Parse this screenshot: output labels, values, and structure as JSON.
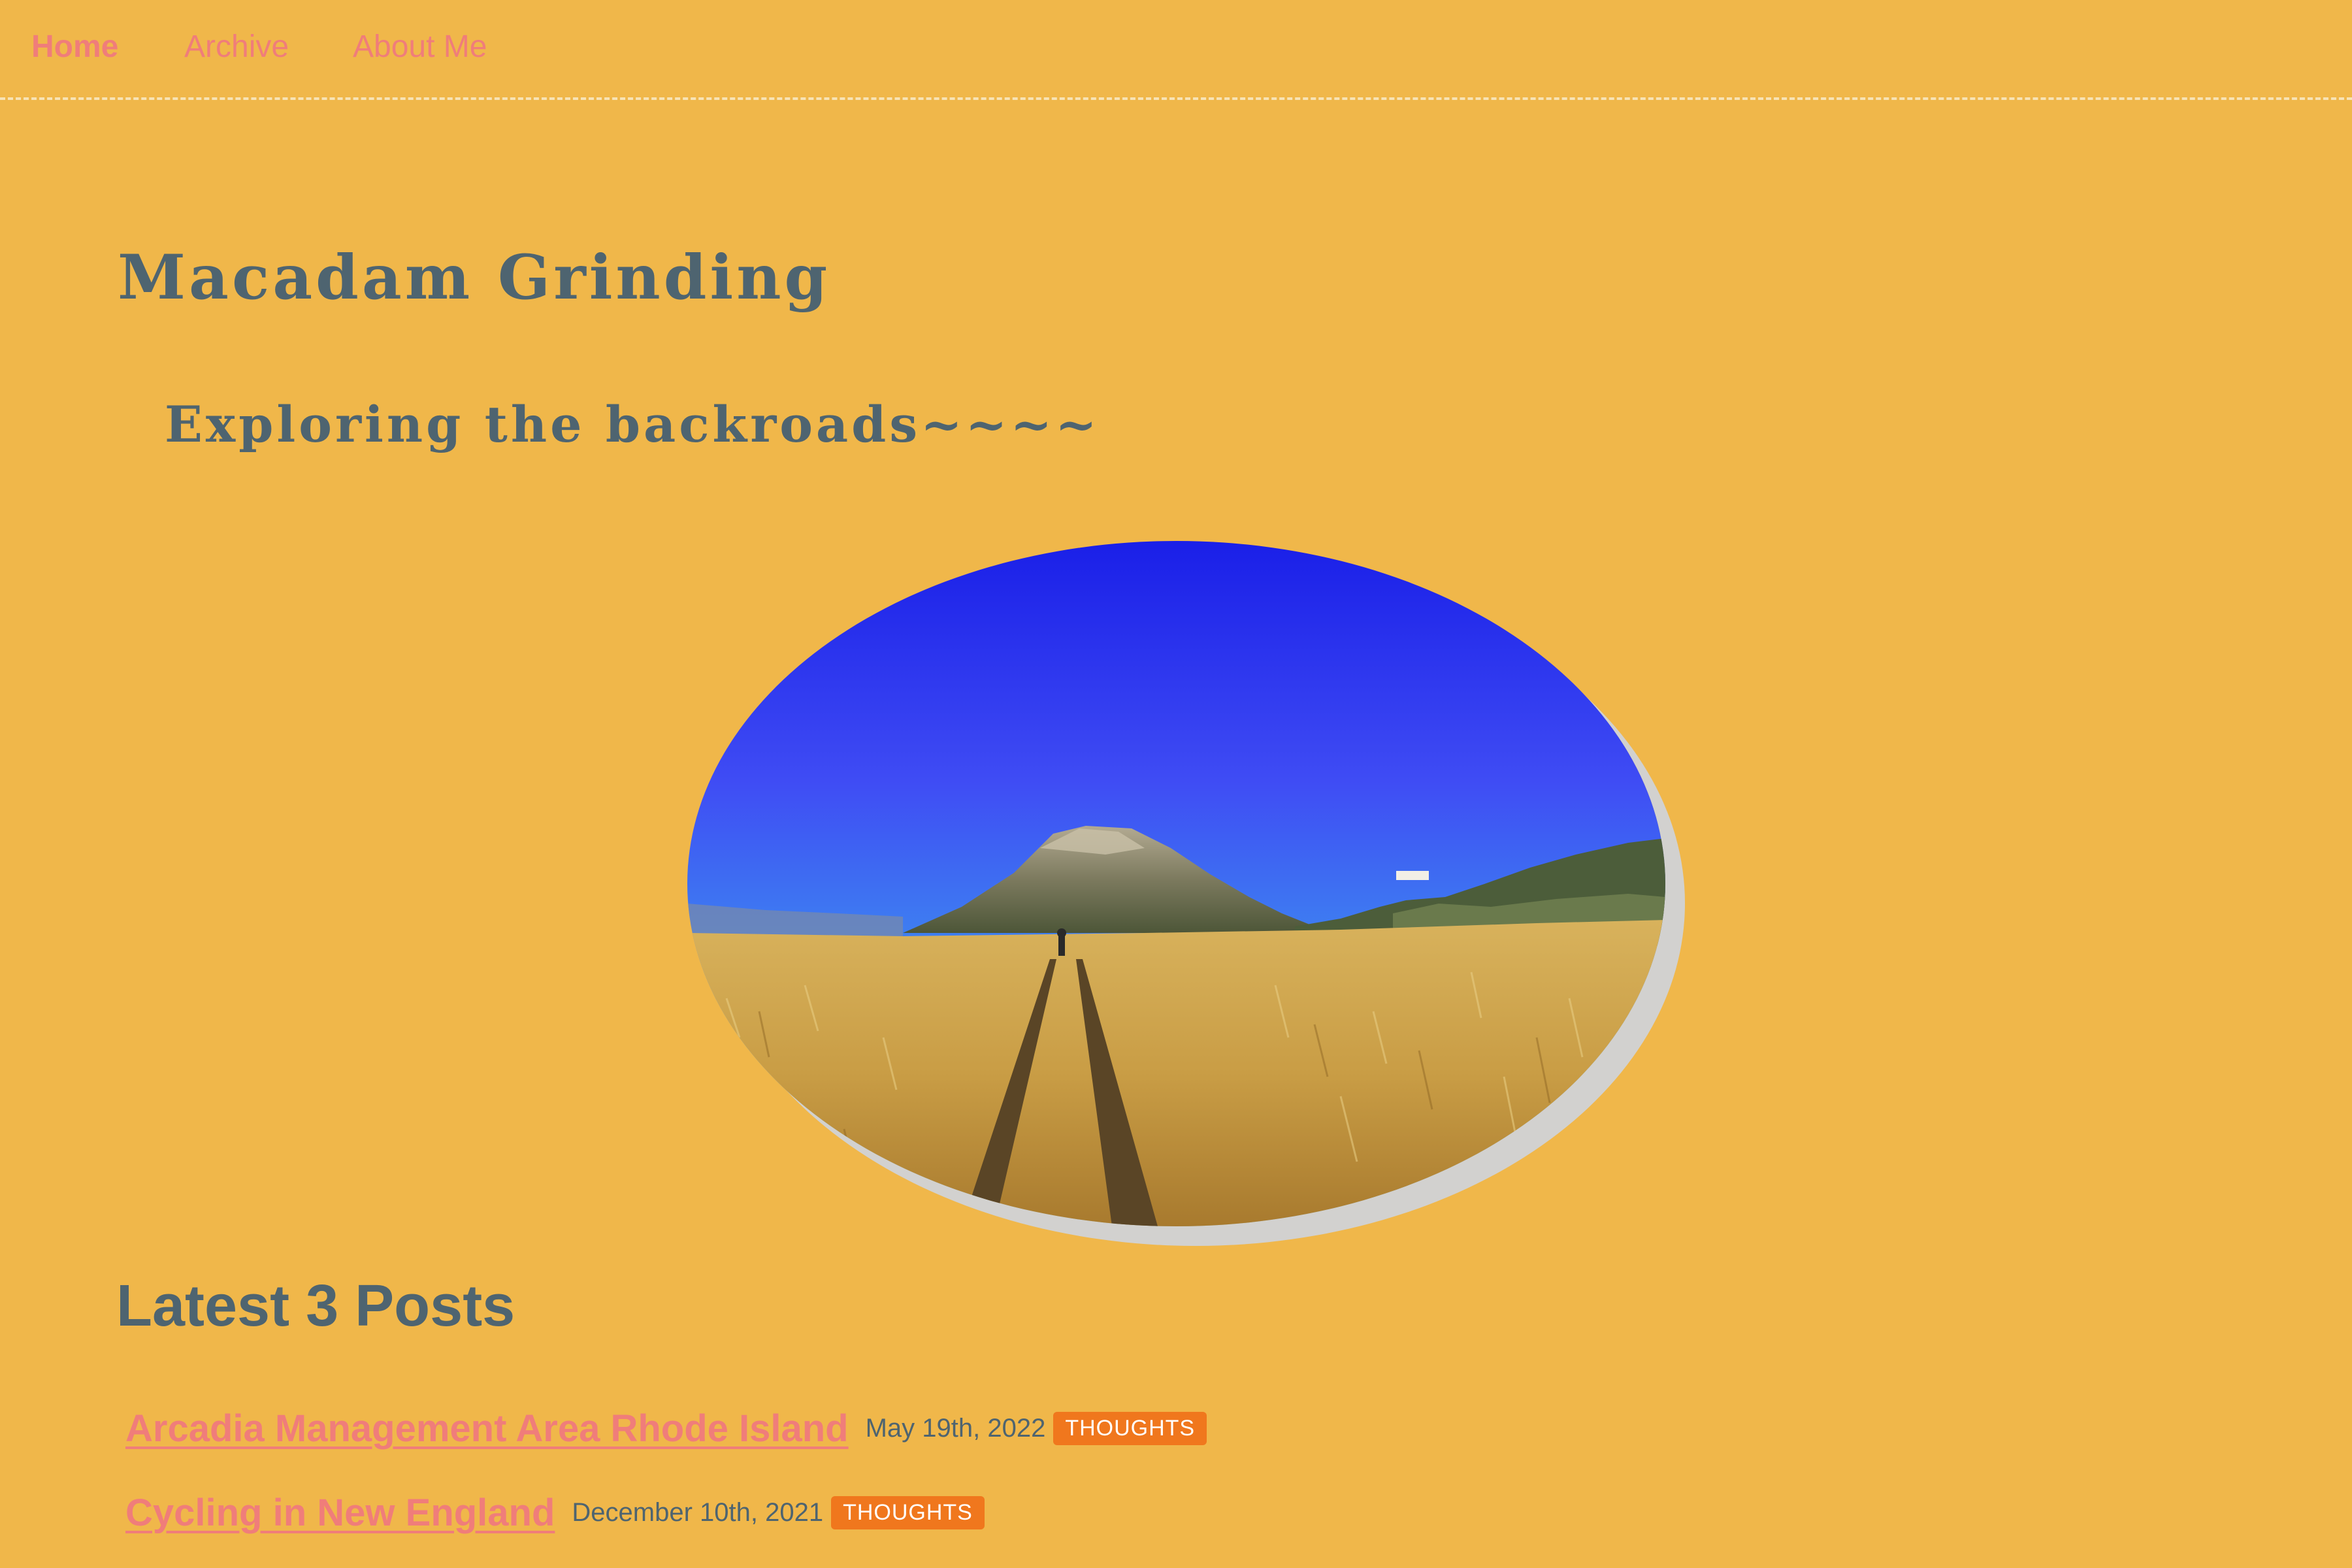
{
  "nav": {
    "items": [
      {
        "label": "Home",
        "active": true
      },
      {
        "label": "Archive",
        "active": false
      },
      {
        "label": "About Me",
        "active": false
      }
    ]
  },
  "header": {
    "title": "Macadam Grinding",
    "subtitle": "Exploring the backroads~~~~"
  },
  "hero": {
    "image_semantic": "golden grass field with dirt double-track leading to a rocky hill under blue sky"
  },
  "posts": {
    "heading": "Latest 3 Posts",
    "items": [
      {
        "title": "Arcadia Management Area Rhode Island",
        "date": "May 19th, 2022",
        "tag": "THOUGHTS"
      },
      {
        "title": "Cycling in New England",
        "date": "December 10th, 2021",
        "tag": "THOUGHTS"
      }
    ]
  },
  "colors": {
    "background": "#f0b74a",
    "link": "#f07d7a",
    "heading": "#4e6470",
    "tag": "#f0771d",
    "hero_shadow": "#d2d1cf"
  }
}
